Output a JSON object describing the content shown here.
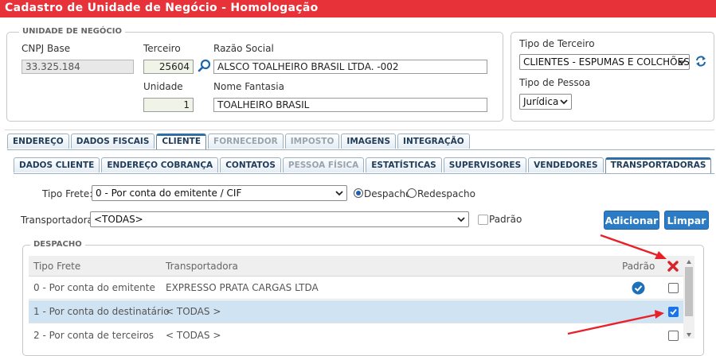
{
  "window": {
    "title": "Cadastro de Unidade de Negócio  - Homologação"
  },
  "business_unit": {
    "legend": "Unidade de Negócio",
    "cnpj_label": "CNPJ Base",
    "cnpj_value": "33.325.184",
    "terceiro_label": "Terceiro",
    "terceiro_value": "25604",
    "razao_label": "Razão Social",
    "razao_value": "ALSCO TOALHEIRO BRASIL LTDA. -002",
    "unidade_label": "Unidade",
    "unidade_value": "1",
    "fantasia_label": "Nome Fantasia",
    "fantasia_value": "TOALHEIRO BRASIL"
  },
  "side_panel": {
    "tipo_terceiro_label": "Tipo de Terceiro",
    "tipo_terceiro_value": "CLIENTES - ESPUMAS E COLCHÕES",
    "tipo_pessoa_label": "Tipo de Pessoa",
    "tipo_pessoa_value": "Jurídica"
  },
  "main_tabs": [
    {
      "label": "Endereço",
      "state": "normal"
    },
    {
      "label": "Dados Fiscais",
      "state": "normal"
    },
    {
      "label": "Cliente",
      "state": "active"
    },
    {
      "label": "Fornecedor",
      "state": "disabled"
    },
    {
      "label": "Imposto",
      "state": "disabled"
    },
    {
      "label": "Imagens",
      "state": "normal"
    },
    {
      "label": "Integração",
      "state": "normal"
    }
  ],
  "sub_tabs": [
    {
      "label": "Dados Cliente",
      "state": "normal"
    },
    {
      "label": "Endereço Cobrança",
      "state": "normal"
    },
    {
      "label": "Contatos",
      "state": "normal"
    },
    {
      "label": "Pessoa Física",
      "state": "disabled"
    },
    {
      "label": "Estatísticas",
      "state": "normal"
    },
    {
      "label": "Supervisores",
      "state": "normal"
    },
    {
      "label": "Vendedores",
      "state": "normal"
    },
    {
      "label": "Transportadoras",
      "state": "active"
    }
  ],
  "form": {
    "tipo_frete_label": "Tipo Frete:",
    "tipo_frete_value": "0 - Por conta do emitente / CIF",
    "radio_despacho": "Despacho",
    "radio_redespacho": "Redespacho",
    "transportadora_label": "Transportadora:",
    "transportadora_value": "<TODAS>",
    "padrao_label": "Padrão",
    "add_button": "Adicionar",
    "clear_button": "Limpar"
  },
  "despacho": {
    "legend": "Despacho",
    "columns": [
      "Tipo Frete",
      "Transportadora",
      "Padrão"
    ],
    "rows": [
      {
        "tipo_frete": "0 - Por conta do emitente",
        "transportadora": "EXPRESSO PRATA CARGAS LTDA",
        "padrao": true,
        "checked": false,
        "selected": false
      },
      {
        "tipo_frete": "1 - Por conta do destinatário",
        "transportadora": "< TODAS >",
        "padrao": false,
        "checked": true,
        "selected": true
      },
      {
        "tipo_frete": "2 - Por conta de terceiros",
        "transportadora": "< TODAS >",
        "padrao": false,
        "checked": false,
        "selected": false
      }
    ]
  },
  "colors": {
    "title_bar": "#e8323a",
    "button": "#2b7cc4",
    "selected_row": "#cfe3f3",
    "annotation_arrow": "#e8202a"
  }
}
